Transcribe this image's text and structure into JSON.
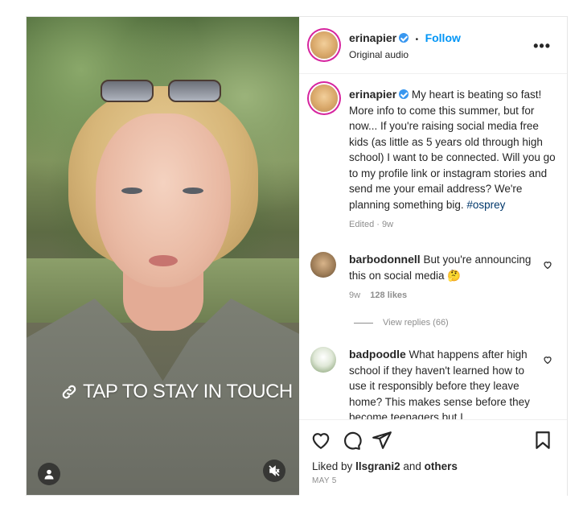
{
  "video": {
    "cta_text": "TAP TO STAY IN TOUCH",
    "icons": [
      "link-icon",
      "user-tag-icon",
      "mute-icon"
    ]
  },
  "header": {
    "username": "erinapier",
    "separator": "•",
    "follow_label": "Follow",
    "subtitle": "Original audio",
    "more_label": "•••"
  },
  "caption": {
    "username": "erinapier",
    "text": "My heart is beating so fast! More info to come this summer, but for now... If you're raising social media free kids (as little as 5 years old through high school) I want to be connected. Will you go to my profile link or instagram stories and send me your email address? We're planning something big.",
    "hashtag": "#osprey",
    "meta": "Edited · 9w"
  },
  "comments": [
    {
      "username": "barbodonnell",
      "text": "But you're announcing this on social media 🤔",
      "age": "9w",
      "likes": "128 likes"
    },
    {
      "username": "badpoodle",
      "text": "What happens after high school if they haven't learned how to use it responsibly before they leave home? This makes sense before they become teenagers but I"
    }
  ],
  "view_replies_label": "View replies (66)",
  "actions": {
    "liked_prefix": "Liked by",
    "liked_user": "llsgrani2",
    "liked_and": "and",
    "liked_others": "others",
    "date": "MAY 5"
  },
  "colors": {
    "link": "#0095f6",
    "verified": "#3897f0",
    "muted_text": "#8e8e8e",
    "hashtag": "#00376b"
  }
}
